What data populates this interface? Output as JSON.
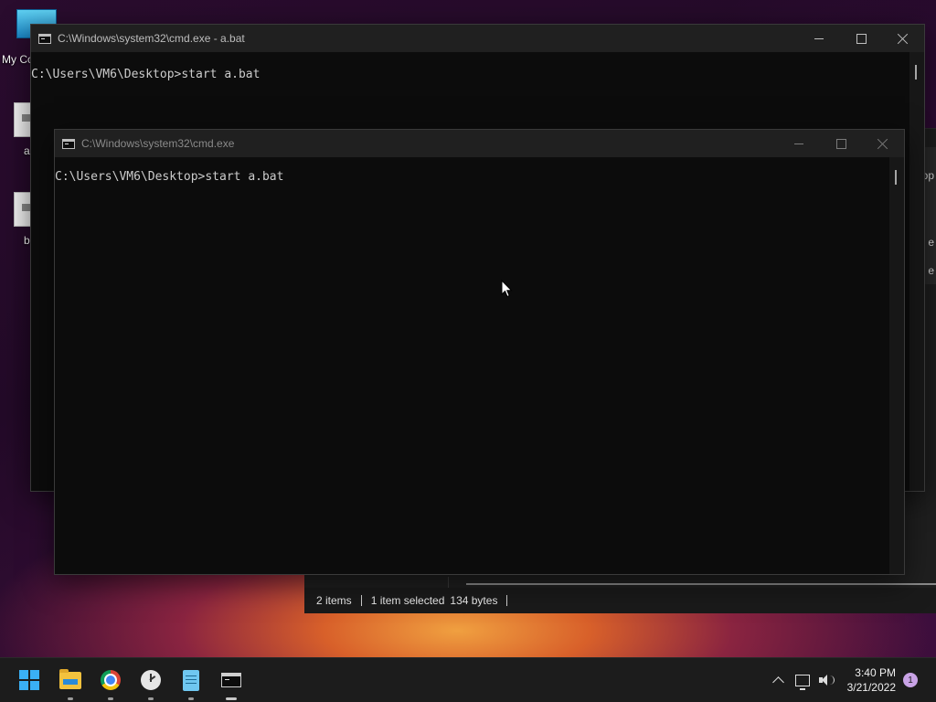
{
  "desktop": {
    "icons": [
      {
        "label": "My Co"
      },
      {
        "label": "a"
      },
      {
        "label": "b"
      }
    ]
  },
  "explorer": {
    "right_labels": [
      "op",
      "e",
      "e"
    ],
    "status": {
      "items": "2 items",
      "selected": "1 item selected",
      "size": "134 bytes"
    }
  },
  "cmd_back": {
    "title": "C:\\Windows\\system32\\cmd.exe - a.bat",
    "line": "C:\\Users\\VM6\\Desktop>start a.bat"
  },
  "cmd_front": {
    "title": "C:\\Windows\\system32\\cmd.exe",
    "line": "C:\\Users\\VM6\\Desktop>start a.bat"
  },
  "taskbar": {
    "apps": [
      "start-button",
      "file-explorer",
      "chrome",
      "yandex-browser",
      "notepad",
      "command-prompt"
    ],
    "clock": {
      "time": "3:40 PM",
      "date": "3/21/2022"
    },
    "notification_count": "1"
  },
  "colors": {
    "console_bg": "#0c0c0c",
    "titlebar_bg": "#202020",
    "taskbar_bg": "#1c1c1c",
    "start_blue": "#3ab0f5"
  }
}
